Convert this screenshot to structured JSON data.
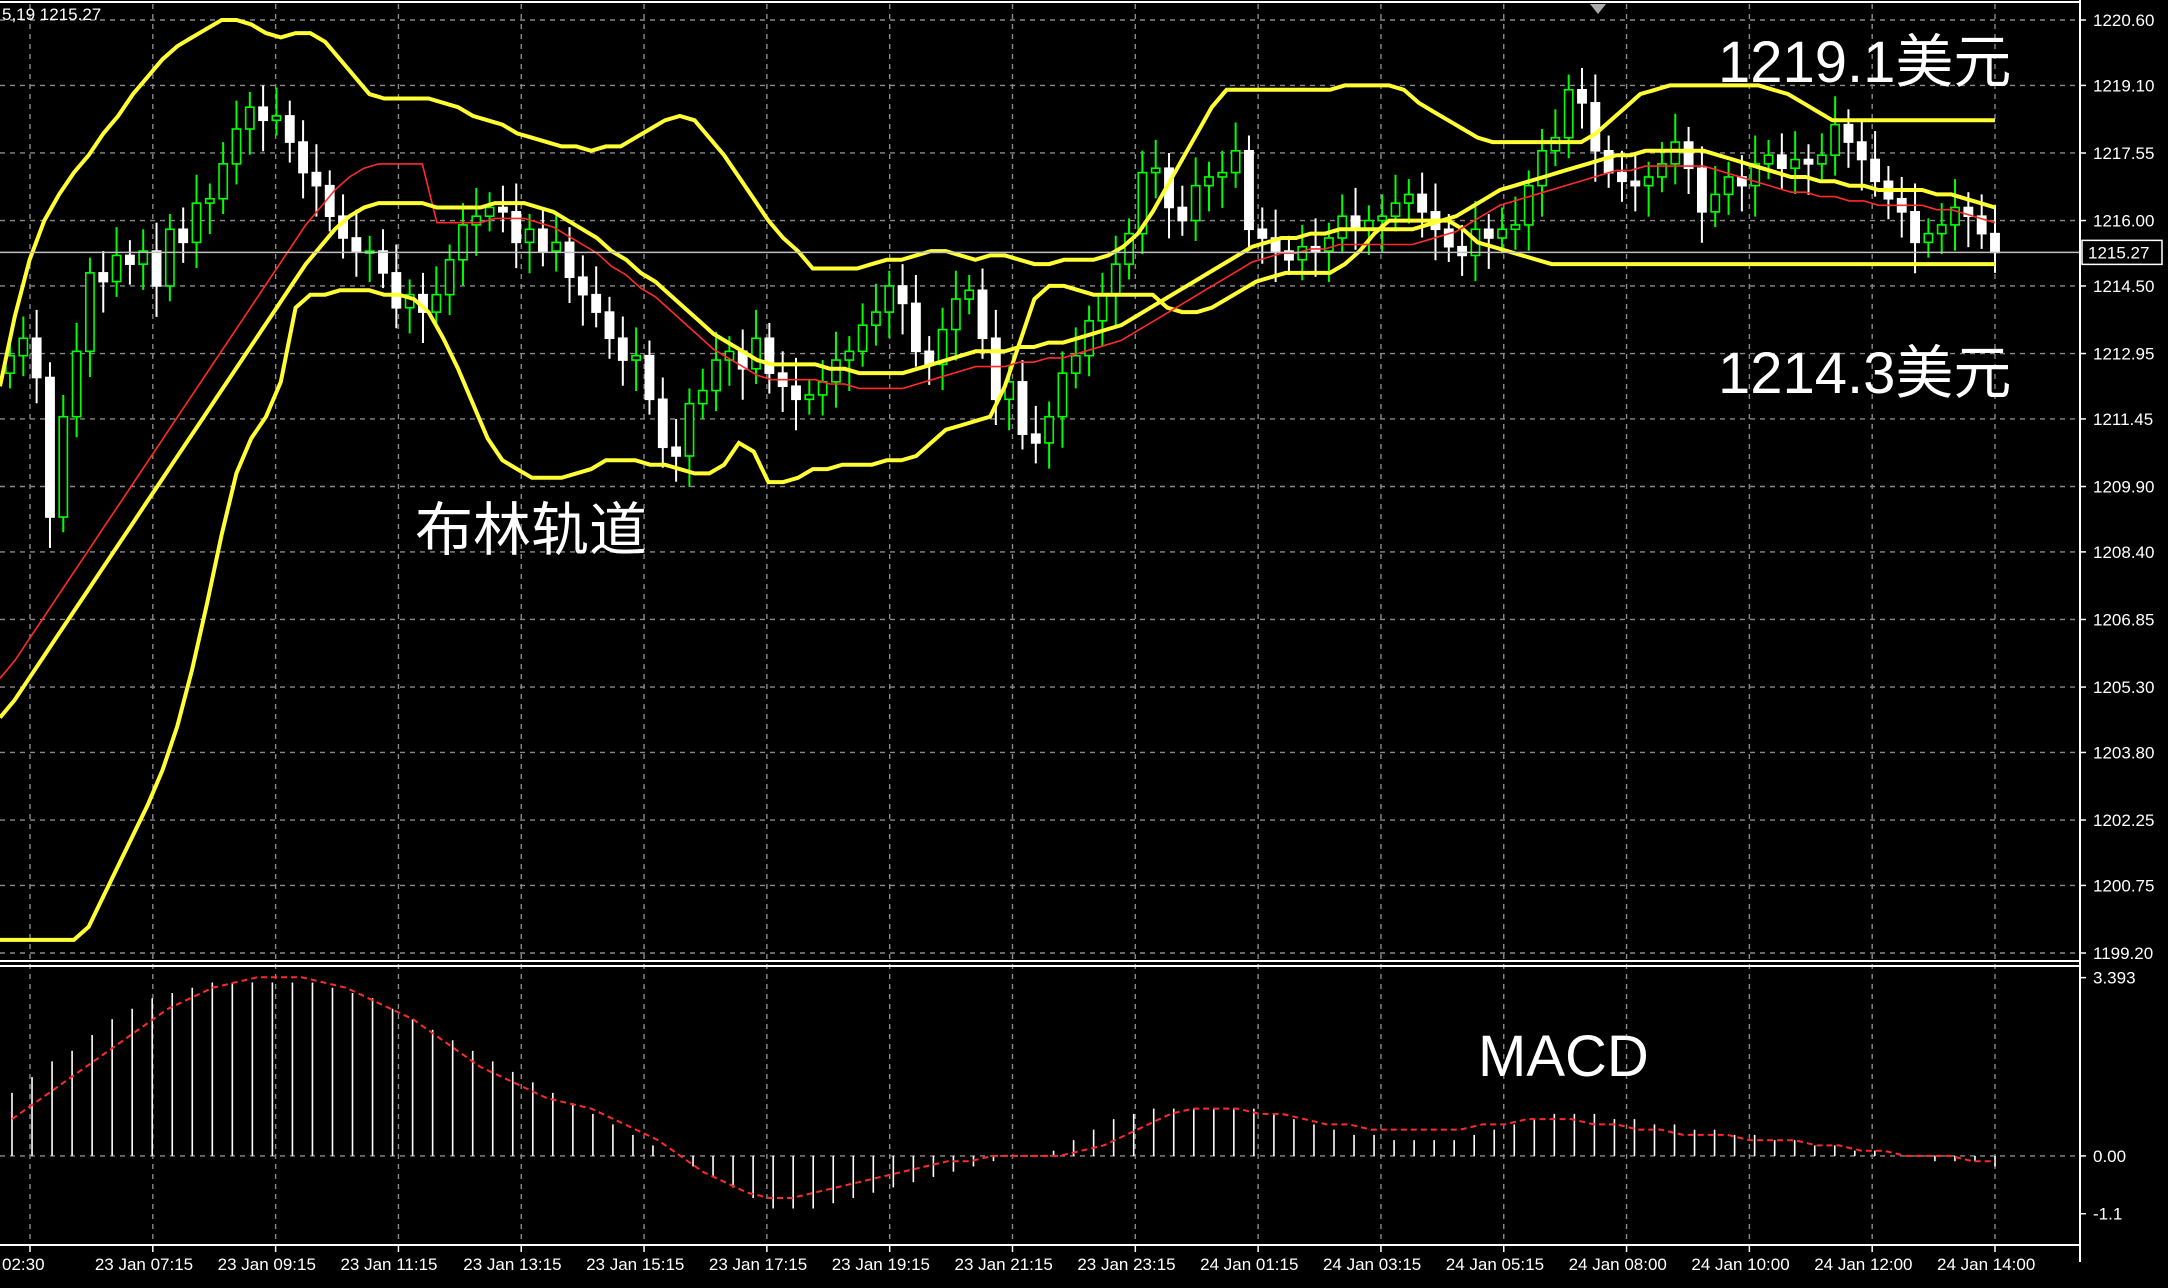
{
  "header": {
    "info": "5,19 1215.27"
  },
  "colors": {
    "background": "#000000",
    "grid": "#8a8a8a",
    "bull_candle": "#00ff00",
    "bear_candle": "#ffffff",
    "bollinger": "#ffff33",
    "moving_average": "#ff2a2a",
    "macd_histogram": "#ffffff",
    "macd_signal": "#ff2a2a",
    "axis_text": "#ffffff",
    "current_price_line": "#c0c0c0"
  },
  "chart_data": [
    {
      "type": "candlestick",
      "panel": "price",
      "title": "",
      "y_ticks": [
        "1220.60",
        "1219.10",
        "1217.55",
        "1216.00",
        "1214.50",
        "1212.95",
        "1211.45",
        "1209.90",
        "1208.40",
        "1206.85",
        "1205.30",
        "1203.80",
        "1202.25",
        "1200.75",
        "1199.20"
      ],
      "ylim": [
        1199.2,
        1220.6
      ],
      "current_price": 1215.27,
      "current_price_label": "1215.27",
      "grid": true,
      "annotations": [
        {
          "text": "1219.1美元",
          "position": "top-right"
        },
        {
          "text": "1214.3美元",
          "position": "right"
        },
        {
          "text": "布林轨道",
          "position": "left-middle"
        }
      ],
      "close": [
        1212.9,
        1213.3,
        1212.4,
        1209.2,
        1211.5,
        1213.0,
        1214.8,
        1214.6,
        1215.2,
        1215.0,
        1215.3,
        1214.5,
        1215.8,
        1215.5,
        1216.4,
        1216.5,
        1217.3,
        1218.1,
        1218.6,
        1218.3,
        1218.4,
        1217.8,
        1217.1,
        1216.8,
        1216.1,
        1215.6,
        1215.3,
        1215.3,
        1214.8,
        1214.0,
        1214.3,
        1213.9,
        1214.3,
        1215.1,
        1215.9,
        1216.1,
        1216.3,
        1216.2,
        1215.5,
        1215.8,
        1215.3,
        1215.5,
        1214.7,
        1214.3,
        1213.9,
        1213.3,
        1212.8,
        1212.9,
        1211.9,
        1210.8,
        1210.6,
        1211.8,
        1212.1,
        1212.8,
        1213.0,
        1212.6,
        1213.3,
        1212.5,
        1212.2,
        1211.9,
        1212.0,
        1212.3,
        1212.8,
        1213.0,
        1213.6,
        1213.9,
        1214.5,
        1214.1,
        1213.0,
        1212.7,
        1213.5,
        1214.2,
        1214.4,
        1213.3,
        1211.9,
        1212.3,
        1211.1,
        1210.9,
        1211.5,
        1212.5,
        1212.9,
        1213.7,
        1214.3,
        1215.0,
        1215.7,
        1217.1,
        1217.2,
        1216.3,
        1216.0,
        1216.8,
        1217.0,
        1217.1,
        1217.6,
        1215.8,
        1215.6,
        1215.3,
        1215.1,
        1215.4,
        1215.3,
        1215.6,
        1216.1,
        1215.8,
        1216.0,
        1216.1,
        1216.4,
        1216.6,
        1216.2,
        1215.8,
        1215.4,
        1215.2,
        1215.8,
        1215.6,
        1215.8,
        1215.9,
        1216.8,
        1217.6,
        1217.9,
        1219.0,
        1218.7,
        1217.6,
        1217.1,
        1216.9,
        1216.8,
        1217.0,
        1217.3,
        1217.8,
        1217.2,
        1216.2,
        1216.6,
        1217.0,
        1216.8,
        1217.3,
        1217.5,
        1217.2,
        1217.4,
        1217.3,
        1217.5,
        1218.2,
        1217.8,
        1217.4,
        1216.9,
        1216.5,
        1216.2,
        1215.5,
        1215.7,
        1215.9,
        1216.3,
        1216.1,
        1215.7,
        1215.27
      ],
      "bollinger_upper": [
        1212.2,
        1213.8,
        1215.1,
        1216.0,
        1216.6,
        1217.1,
        1217.5,
        1218.0,
        1218.4,
        1218.9,
        1219.3,
        1219.7,
        1220.0,
        1220.2,
        1220.4,
        1220.6,
        1220.6,
        1220.5,
        1220.3,
        1220.2,
        1220.3,
        1220.3,
        1220.1,
        1219.7,
        1219.3,
        1218.9,
        1218.8,
        1218.8,
        1218.8,
        1218.8,
        1218.7,
        1218.6,
        1218.4,
        1218.3,
        1218.2,
        1218.0,
        1217.9,
        1217.8,
        1217.7,
        1217.7,
        1217.6,
        1217.7,
        1217.7,
        1217.9,
        1218.1,
        1218.3,
        1218.4,
        1218.3,
        1217.9,
        1217.5,
        1217.0,
        1216.5,
        1216.0,
        1215.6,
        1215.3,
        1214.9,
        1214.9,
        1214.9,
        1214.9,
        1215.0,
        1215.1,
        1215.1,
        1215.2,
        1215.3,
        1215.3,
        1215.2,
        1215.1,
        1215.2,
        1215.2,
        1215.1,
        1215.0,
        1215.0,
        1215.1,
        1215.1,
        1215.1,
        1215.2,
        1215.4,
        1215.7,
        1216.2,
        1216.8,
        1217.4,
        1218.0,
        1218.6,
        1219.0,
        1219.0,
        1219.0,
        1219.0,
        1219.0,
        1219.0,
        1219.0,
        1219.0,
        1219.1,
        1219.1,
        1219.1,
        1219.1,
        1219.0,
        1218.7,
        1218.5,
        1218.3,
        1218.1,
        1217.9,
        1217.8,
        1217.8,
        1217.8,
        1217.8,
        1217.8,
        1217.8,
        1217.8,
        1218.0,
        1218.3,
        1218.6,
        1218.9,
        1219.0,
        1219.1,
        1219.1,
        1219.1,
        1219.1,
        1219.1,
        1219.1,
        1219.1,
        1219.0,
        1218.9,
        1218.7,
        1218.5,
        1218.3,
        1218.3,
        1218.3,
        1218.3,
        1218.3,
        1218.3,
        1218.3,
        1218.3,
        1218.3,
        1218.3,
        1218.3,
        1218.3
      ],
      "bollinger_middle": [
        1204.6,
        1205.0,
        1205.5,
        1206.0,
        1206.5,
        1207.0,
        1207.5,
        1208.0,
        1208.5,
        1209.0,
        1209.5,
        1210.0,
        1210.5,
        1211.0,
        1211.5,
        1212.0,
        1212.5,
        1213.0,
        1213.5,
        1214.0,
        1214.5,
        1215.0,
        1215.4,
        1215.8,
        1216.1,
        1216.3,
        1216.4,
        1216.4,
        1216.4,
        1216.4,
        1216.3,
        1216.3,
        1216.3,
        1216.3,
        1216.4,
        1216.4,
        1216.4,
        1216.3,
        1216.2,
        1216.0,
        1215.8,
        1215.6,
        1215.3,
        1215.1,
        1214.8,
        1214.6,
        1214.3,
        1214.0,
        1213.7,
        1213.4,
        1213.2,
        1213.0,
        1212.8,
        1212.7,
        1212.7,
        1212.7,
        1212.7,
        1212.6,
        1212.6,
        1212.5,
        1212.5,
        1212.5,
        1212.5,
        1212.6,
        1212.7,
        1212.8,
        1212.9,
        1213.0,
        1213.0,
        1213.0,
        1213.1,
        1213.1,
        1213.2,
        1213.2,
        1213.3,
        1213.4,
        1213.5,
        1213.6,
        1213.8,
        1214.0,
        1214.2,
        1214.4,
        1214.6,
        1214.8,
        1215.0,
        1215.2,
        1215.4,
        1215.5,
        1215.6,
        1215.6,
        1215.7,
        1215.7,
        1215.8,
        1215.8,
        1215.8,
        1215.8,
        1215.8,
        1215.8,
        1215.9,
        1216.0,
        1216.1,
        1216.3,
        1216.5,
        1216.7,
        1216.8,
        1216.9,
        1217.0,
        1217.1,
        1217.2,
        1217.3,
        1217.4,
        1217.5,
        1217.5,
        1217.6,
        1217.6,
        1217.6,
        1217.6,
        1217.6,
        1217.5,
        1217.4,
        1217.3,
        1217.2,
        1217.1,
        1217.0,
        1217.0,
        1216.9,
        1216.9,
        1216.8,
        1216.8,
        1216.7,
        1216.7,
        1216.7,
        1216.7,
        1216.6,
        1216.6,
        1216.5,
        1216.4,
        1216.3
      ],
      "bollinger_lower": [
        1199.5,
        1199.5,
        1199.5,
        1199.5,
        1199.5,
        1199.5,
        1199.8,
        1200.5,
        1201.2,
        1201.9,
        1202.6,
        1203.4,
        1204.4,
        1205.7,
        1207.2,
        1208.8,
        1210.2,
        1211.0,
        1211.5,
        1212.3,
        1214.0,
        1214.3,
        1214.3,
        1214.4,
        1214.4,
        1214.4,
        1214.3,
        1214.3,
        1214.2,
        1213.9,
        1213.3,
        1212.6,
        1211.8,
        1211.0,
        1210.5,
        1210.3,
        1210.1,
        1210.1,
        1210.1,
        1210.2,
        1210.3,
        1210.5,
        1210.5,
        1210.5,
        1210.4,
        1210.4,
        1210.3,
        1210.2,
        1210.2,
        1210.4,
        1210.9,
        1210.7,
        1210.0,
        1210.0,
        1210.1,
        1210.3,
        1210.3,
        1210.4,
        1210.4,
        1210.4,
        1210.5,
        1210.5,
        1210.6,
        1210.9,
        1211.2,
        1211.3,
        1211.4,
        1211.5,
        1212.2,
        1213.2,
        1214.2,
        1214.5,
        1214.5,
        1214.4,
        1214.3,
        1214.3,
        1214.3,
        1214.3,
        1214.3,
        1214.0,
        1213.9,
        1213.9,
        1214.0,
        1214.2,
        1214.4,
        1214.6,
        1214.7,
        1214.8,
        1214.8,
        1214.8,
        1214.8,
        1215.0,
        1215.3,
        1215.7,
        1216.0,
        1216.0,
        1216.0,
        1216.0,
        1216.0,
        1215.8,
        1215.5,
        1215.4,
        1215.3,
        1215.2,
        1215.1,
        1215.0,
        1215.0,
        1215.0,
        1215.0,
        1215.0,
        1215.0,
        1215.0,
        1215.0,
        1215.0,
        1215.0,
        1215.0,
        1215.0,
        1215.0,
        1215.0,
        1215.0,
        1215.0,
        1215.0,
        1215.0,
        1215.0,
        1215.0,
        1215.0,
        1215.0,
        1215.0,
        1215.0,
        1215.0,
        1215.0,
        1215.0,
        1215.0,
        1215.0,
        1215.0,
        1215.0
      ]
    },
    {
      "type": "macd",
      "panel": "indicator",
      "title": "MACD",
      "y_ticks": [
        "3.393",
        "0.00",
        "-1.1"
      ],
      "ylim": [
        -1.6,
        3.5
      ],
      "histogram": [
        1.2,
        1.5,
        1.8,
        2.0,
        2.3,
        2.6,
        2.8,
        3.0,
        3.1,
        3.2,
        3.3,
        3.3,
        3.3,
        3.3,
        3.3,
        3.3,
        3.2,
        3.1,
        3.0,
        2.8,
        2.6,
        2.4,
        2.2,
        2.0,
        1.8,
        1.6,
        1.4,
        1.2,
        1.0,
        0.8,
        0.6,
        0.4,
        0.2,
        0.0,
        -0.2,
        -0.4,
        -0.6,
        -0.8,
        -1.0,
        -1.0,
        -1.0,
        -0.9,
        -0.8,
        -0.7,
        -0.6,
        -0.5,
        -0.4,
        -0.3,
        -0.2,
        -0.1,
        0.0,
        0.0,
        0.1,
        0.3,
        0.5,
        0.7,
        0.8,
        0.9,
        0.9,
        0.9,
        0.9,
        0.9,
        0.9,
        0.8,
        0.7,
        0.6,
        0.5,
        0.4,
        0.4,
        0.3,
        0.3,
        0.3,
        0.3,
        0.4,
        0.5,
        0.6,
        0.7,
        0.8,
        0.8,
        0.8,
        0.7,
        0.7,
        0.6,
        0.6,
        0.5,
        0.5,
        0.4,
        0.4,
        0.3,
        0.3,
        0.2,
        0.2,
        0.1,
        0.1,
        0.0,
        0.0,
        -0.1,
        -0.1,
        -0.1,
        -0.2
      ],
      "signal": [
        0.7,
        1.0,
        1.3,
        1.6,
        1.9,
        2.2,
        2.5,
        2.8,
        3.0,
        3.2,
        3.3,
        3.4,
        3.4,
        3.4,
        3.3,
        3.2,
        3.0,
        2.8,
        2.6,
        2.3,
        2.0,
        1.7,
        1.5,
        1.3,
        1.1,
        1.0,
        0.9,
        0.7,
        0.5,
        0.3,
        0.0,
        -0.3,
        -0.5,
        -0.7,
        -0.8,
        -0.8,
        -0.7,
        -0.6,
        -0.5,
        -0.4,
        -0.3,
        -0.2,
        -0.1,
        -0.1,
        0.0,
        0.0,
        0.0,
        0.0,
        0.1,
        0.2,
        0.4,
        0.6,
        0.8,
        0.9,
        0.9,
        0.9,
        0.8,
        0.8,
        0.7,
        0.6,
        0.6,
        0.5,
        0.5,
        0.5,
        0.5,
        0.5,
        0.6,
        0.6,
        0.7,
        0.7,
        0.7,
        0.6,
        0.6,
        0.5,
        0.5,
        0.4,
        0.4,
        0.4,
        0.3,
        0.3,
        0.3,
        0.2,
        0.2,
        0.1,
        0.1,
        0.0,
        0.0,
        0.0,
        -0.1,
        -0.1
      ]
    }
  ],
  "x_labels": [
    "02:30",
    "23 Jan 07:15",
    "23 Jan 09:15",
    "23 Jan 11:15",
    "23 Jan 13:15",
    "23 Jan 15:15",
    "23 Jan 17:15",
    "23 Jan 19:15",
    "23 Jan 21:15",
    "23 Jan 23:15",
    "24 Jan 01:15",
    "24 Jan 03:15",
    "24 Jan 05:15",
    "24 Jan 08:00",
    "24 Jan 10:00",
    "24 Jan 12:00",
    "24 Jan 14:00"
  ]
}
